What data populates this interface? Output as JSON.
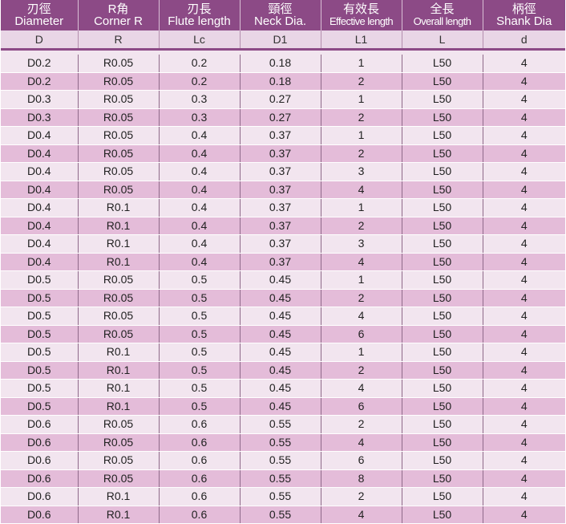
{
  "columns": [
    {
      "ja": "刃徑",
      "en": "Diameter",
      "symbol": "D"
    },
    {
      "ja": "R角",
      "en": "Corner R",
      "symbol": "R"
    },
    {
      "ja": "刃長",
      "en": "Flute length",
      "symbol": "Lc"
    },
    {
      "ja": "頸徑",
      "en": "Neck Dia.",
      "symbol": "D1"
    },
    {
      "ja": "有效長",
      "en": "Effective length",
      "symbol": "L1"
    },
    {
      "ja": "全長",
      "en": "Overall length",
      "symbol": "L"
    },
    {
      "ja": "柄徑",
      "en": "Shank Dia",
      "symbol": "d"
    }
  ],
  "rows": [
    [
      "D0.2",
      "R0.05",
      "0.2",
      "0.18",
      "1",
      "L50",
      "4"
    ],
    [
      "D0.2",
      "R0.05",
      "0.2",
      "0.18",
      "2",
      "L50",
      "4"
    ],
    [
      "D0.3",
      "R0.05",
      "0.3",
      "0.27",
      "1",
      "L50",
      "4"
    ],
    [
      "D0.3",
      "R0.05",
      "0.3",
      "0.27",
      "2",
      "L50",
      "4"
    ],
    [
      "D0.4",
      "R0.05",
      "0.4",
      "0.37",
      "1",
      "L50",
      "4"
    ],
    [
      "D0.4",
      "R0.05",
      "0.4",
      "0.37",
      "2",
      "L50",
      "4"
    ],
    [
      "D0.4",
      "R0.05",
      "0.4",
      "0.37",
      "3",
      "L50",
      "4"
    ],
    [
      "D0.4",
      "R0.05",
      "0.4",
      "0.37",
      "4",
      "L50",
      "4"
    ],
    [
      "D0.4",
      "R0.1",
      "0.4",
      "0.37",
      "1",
      "L50",
      "4"
    ],
    [
      "D0.4",
      "R0.1",
      "0.4",
      "0.37",
      "2",
      "L50",
      "4"
    ],
    [
      "D0.4",
      "R0.1",
      "0.4",
      "0.37",
      "3",
      "L50",
      "4"
    ],
    [
      "D0.4",
      "R0.1",
      "0.4",
      "0.37",
      "4",
      "L50",
      "4"
    ],
    [
      "D0.5",
      "R0.05",
      "0.5",
      "0.45",
      "1",
      "L50",
      "4"
    ],
    [
      "D0.5",
      "R0.05",
      "0.5",
      "0.45",
      "2",
      "L50",
      "4"
    ],
    [
      "D0.5",
      "R0.05",
      "0.5",
      "0.45",
      "4",
      "L50",
      "4"
    ],
    [
      "D0.5",
      "R0.05",
      "0.5",
      "0.45",
      "6",
      "L50",
      "4"
    ],
    [
      "D0.5",
      "R0.1",
      "0.5",
      "0.45",
      "1",
      "L50",
      "4"
    ],
    [
      "D0.5",
      "R0.1",
      "0.5",
      "0.45",
      "2",
      "L50",
      "4"
    ],
    [
      "D0.5",
      "R0.1",
      "0.5",
      "0.45",
      "4",
      "L50",
      "4"
    ],
    [
      "D0.5",
      "R0.1",
      "0.5",
      "0.45",
      "6",
      "L50",
      "4"
    ],
    [
      "D0.6",
      "R0.05",
      "0.6",
      "0.55",
      "2",
      "L50",
      "4"
    ],
    [
      "D0.6",
      "R0.05",
      "0.6",
      "0.55",
      "4",
      "L50",
      "4"
    ],
    [
      "D0.6",
      "R0.05",
      "0.6",
      "0.55",
      "6",
      "L50",
      "4"
    ],
    [
      "D0.6",
      "R0.05",
      "0.6",
      "0.55",
      "8",
      "L50",
      "4"
    ],
    [
      "D0.6",
      "R0.1",
      "0.6",
      "0.55",
      "2",
      "L50",
      "4"
    ],
    [
      "D0.6",
      "R0.1",
      "0.6",
      "0.55",
      "4",
      "L50",
      "4"
    ]
  ]
}
